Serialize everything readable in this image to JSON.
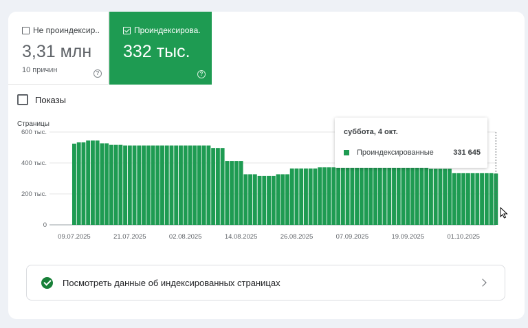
{
  "tabs": [
    {
      "label": "Не проиндексир...",
      "value": "3,31 млн",
      "sub": "10 причин",
      "selected": false
    },
    {
      "label": "Проиндексирова...",
      "value": "332 тыс.",
      "selected": true
    }
  ],
  "shows_label": "Показы",
  "chart_data": {
    "type": "bar",
    "ylabel": "Страницы",
    "ylim": [
      0,
      600000
    ],
    "y_ticks": [
      "600 тыс.",
      "400 тыс.",
      "200 тыс.",
      "0"
    ],
    "y_tick_values": [
      600000,
      400000,
      200000,
      0
    ],
    "x_tick_labels": [
      "09.07.2025",
      "21.07.2025",
      "02.08.2025",
      "14.08.2025",
      "26.08.2025",
      "07.09.2025",
      "19.09.2025",
      "01.10.2025"
    ],
    "x_tick_indices": [
      0,
      12,
      24,
      36,
      48,
      60,
      72,
      84
    ],
    "color": "#1e9b52",
    "series": [
      {
        "name": "Проиндексированные",
        "values": [
          525000,
          533000,
          533000,
          545000,
          545000,
          545000,
          527000,
          527000,
          517000,
          517000,
          517000,
          513000,
          513000,
          513000,
          513000,
          513000,
          513000,
          513000,
          513000,
          513000,
          513000,
          513000,
          513000,
          513000,
          513000,
          513000,
          513000,
          513000,
          513000,
          513000,
          497000,
          497000,
          497000,
          413000,
          413000,
          413000,
          413000,
          327000,
          327000,
          327000,
          316000,
          316000,
          316000,
          316000,
          327000,
          327000,
          327000,
          364000,
          364000,
          364000,
          364000,
          364000,
          364000,
          372000,
          372000,
          372000,
          372000,
          372000,
          372000,
          372000,
          372000,
          372000,
          372000,
          372000,
          372000,
          372000,
          372000,
          372000,
          372000,
          372000,
          372000,
          372000,
          372000,
          372000,
          372000,
          372000,
          372000,
          362000,
          362000,
          362000,
          362000,
          362000,
          334000,
          334000,
          334000,
          334000,
          334000,
          334000,
          334000,
          334000,
          334000,
          331645
        ]
      }
    ]
  },
  "tooltip": {
    "title": "суббота, 4 окт.",
    "series": "Проиндексированные",
    "value": "331 645"
  },
  "link": {
    "label": "Посмотреть данные об индексированных страницах"
  }
}
